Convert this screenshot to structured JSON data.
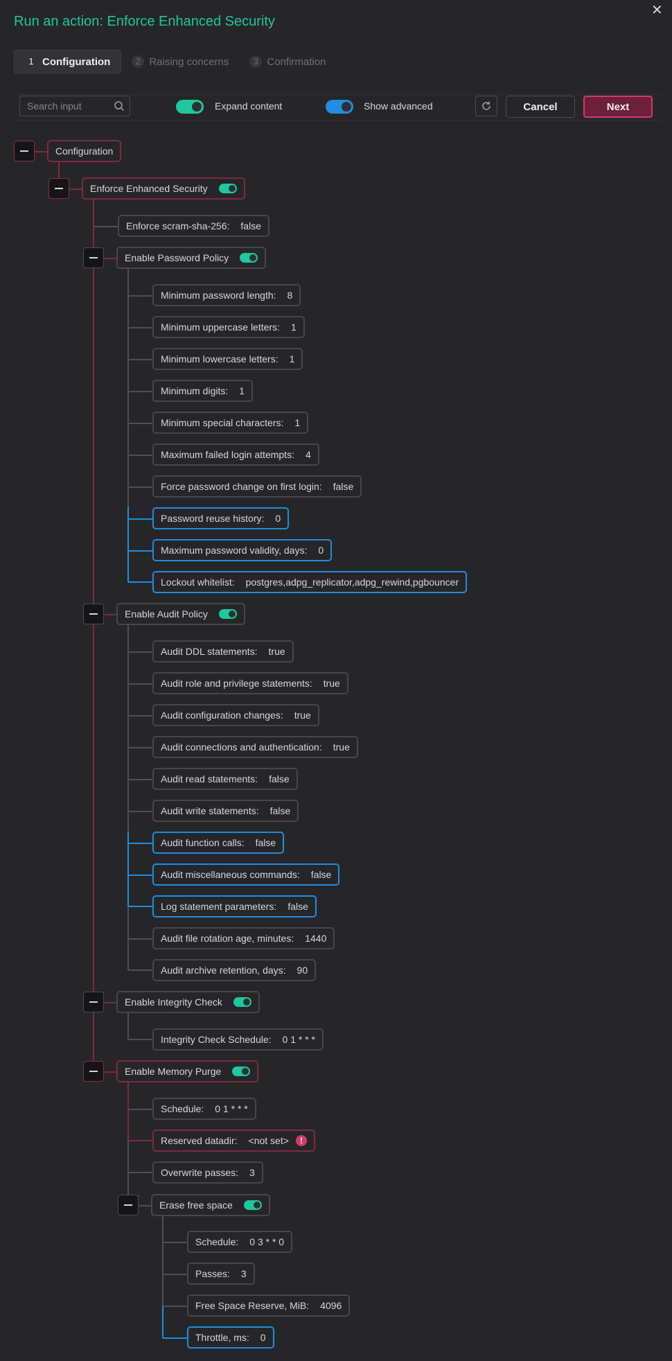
{
  "title": "Run an action: Enforce Enhanced Security",
  "close_icon": "close-icon",
  "steps": [
    {
      "num": "1",
      "label": "Configuration"
    },
    {
      "num": "2",
      "label": "Raising concerns"
    },
    {
      "num": "3",
      "label": "Confirmation"
    }
  ],
  "toolbar": {
    "search_placeholder": "Search input",
    "expand_label": "Expand content",
    "advanced_label": "Show advanced",
    "cancel_label": "Cancel",
    "next_label": "Next"
  },
  "colors": {
    "accent_green": "#1ec8a0",
    "accent_blue": "#1e8ee0",
    "error_red": "#d03b6a",
    "background": "#262629"
  },
  "tree": {
    "root": "Configuration",
    "ees": "Enforce Enhanced Security",
    "scram": {
      "label": "Enforce scram-sha-256:",
      "value": "false"
    },
    "pwd": {
      "label": "Enable Password Policy",
      "items": [
        {
          "label": "Minimum password length:",
          "value": "8"
        },
        {
          "label": "Minimum uppercase letters:",
          "value": "1"
        },
        {
          "label": "Minimum lowercase letters:",
          "value": "1"
        },
        {
          "label": "Minimum digits:",
          "value": "1"
        },
        {
          "label": "Minimum special characters:",
          "value": "1"
        },
        {
          "label": "Maximum failed login attempts:",
          "value": "4"
        },
        {
          "label": "Force password change on first login:",
          "value": "false"
        },
        {
          "label": "Password reuse history:",
          "value": "0"
        },
        {
          "label": "Maximum password validity, days:",
          "value": "0"
        },
        {
          "label": "Lockout whitelist:",
          "value": "postgres,adpg_replicator,adpg_rewind,pgbouncer"
        }
      ]
    },
    "audit": {
      "label": "Enable Audit Policy",
      "items": [
        {
          "label": "Audit DDL statements:",
          "value": "true"
        },
        {
          "label": "Audit role and privilege statements:",
          "value": "true"
        },
        {
          "label": "Audit configuration changes:",
          "value": "true"
        },
        {
          "label": "Audit connections and authentication:",
          "value": "true"
        },
        {
          "label": "Audit read statements:",
          "value": "false"
        },
        {
          "label": "Audit write statements:",
          "value": "false"
        },
        {
          "label": "Audit function calls:",
          "value": "false"
        },
        {
          "label": "Audit miscellaneous commands:",
          "value": "false"
        },
        {
          "label": "Log statement parameters:",
          "value": "false"
        },
        {
          "label": "Audit file rotation age, minutes:",
          "value": "1440"
        },
        {
          "label": "Audit archive retention, days:",
          "value": "90"
        }
      ]
    },
    "integrity": {
      "label": "Enable Integrity Check",
      "items": [
        {
          "label": "Integrity Check Schedule:",
          "value": "0 1 * * *"
        }
      ]
    },
    "memory": {
      "label": "Enable Memory Purge",
      "items": [
        {
          "label": "Schedule:",
          "value": "0 1 * * *"
        },
        {
          "label": "Reserved datadir:",
          "value": "<not set>"
        },
        {
          "label": "Overwrite passes:",
          "value": "3"
        }
      ],
      "erase": {
        "label": "Erase free space",
        "items": [
          {
            "label": "Schedule:",
            "value": "0 3 * * 0"
          },
          {
            "label": "Passes:",
            "value": "3"
          },
          {
            "label": "Free Space Reserve, MiB:",
            "value": "4096"
          },
          {
            "label": "Throttle, ms:",
            "value": "0"
          }
        ]
      }
    }
  }
}
